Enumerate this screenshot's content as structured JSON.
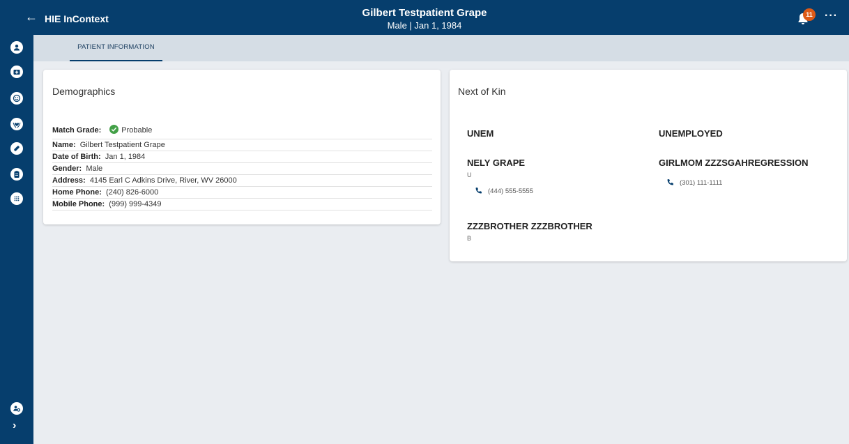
{
  "header": {
    "back_glyph": "←",
    "app_title": "HIE InContext",
    "patient_name": "Gilbert Testpatient Grape",
    "patient_sub": "Male | Jan 1, 1984",
    "notification_count": "11",
    "more_glyph": "···"
  },
  "tabs": [
    {
      "label": "PATIENT INFORMATION"
    }
  ],
  "demographics": {
    "title": "Demographics",
    "match_grade_label": "Match Grade:",
    "match_grade_value": "Probable",
    "fields": [
      {
        "label": "Name:",
        "value": "Gilbert Testpatient Grape"
      },
      {
        "label": "Date of Birth:",
        "value": "Jan 1, 1984"
      },
      {
        "label": "Gender:",
        "value": "Male"
      },
      {
        "label": "Address:",
        "value": "4145 Earl C Adkins Drive, River, WV 26000"
      },
      {
        "label": "Home Phone:",
        "value": "(240) 826-6000"
      },
      {
        "label": "Mobile Phone:",
        "value": "(999) 999-4349"
      }
    ]
  },
  "next_of_kin": {
    "title": "Next of Kin",
    "entries": [
      {
        "name": "UNEM"
      },
      {
        "name": "UNEMPLOYED"
      },
      {
        "name": "NELY GRAPE",
        "relation": "U",
        "phone": "(444) 555-5555"
      },
      {
        "name": "GIRLMOM ZZZSGAHREGRESSION",
        "phone": "(301) 111-1111"
      },
      {
        "name": "ZZZBROTHER ZZZBROTHER",
        "relation": "B"
      }
    ]
  },
  "sidebar": {
    "icons": [
      "account-icon",
      "medical-folder-icon",
      "face-icon",
      "heart-hands-icon",
      "pill-icon",
      "clipboard-icon",
      "apps-grid-icon",
      "user-settings-icon"
    ],
    "chevron_glyph": "›"
  },
  "colors": {
    "primary": "#063e6d",
    "badge": "#dd5a17",
    "success": "#43a047"
  }
}
